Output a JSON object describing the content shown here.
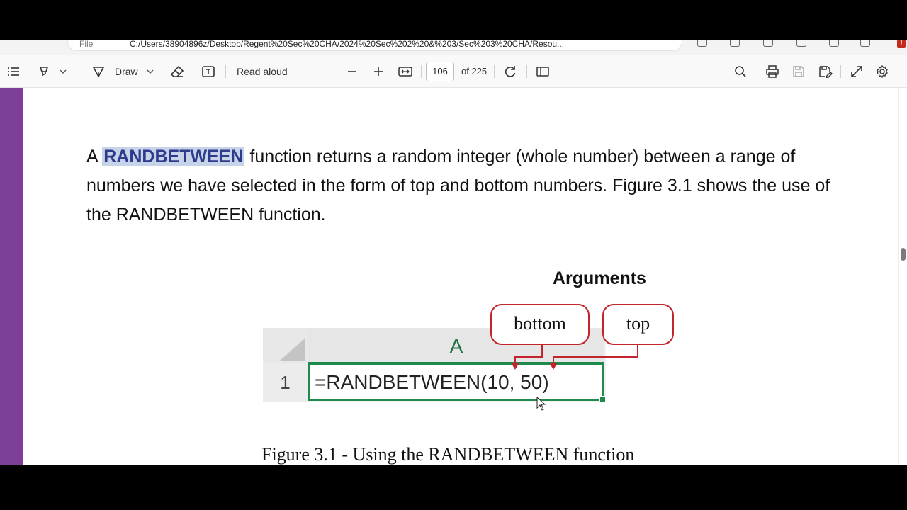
{
  "browser": {
    "scheme": "File",
    "url": "C:/Users/38904896z/Desktop/Regent%20Sec%20CHA/2024%20Sec%202%20&%203/Sec%203%20CHA/Resou..."
  },
  "toolbar": {
    "draw_label": "Draw",
    "read_aloud_label": "Read aloud",
    "page_number": "106",
    "page_total": "of 225"
  },
  "document": {
    "para_prefix": "A ",
    "para_highlight": "RANDBETWEEN",
    "para_rest": " function returns a random integer (whole number) between a range of numbers we have selected in the form of top and bottom numbers. Figure 3.1 shows the use of the RANDBETWEEN function.",
    "figure": {
      "heading": "Arguments",
      "bubble_bottom": "bottom",
      "bubble_top": "top",
      "column_header": "A",
      "row_header": "1",
      "cell_formula": "=RANDBETWEEN(10, 50)",
      "caption": "Figure 3.1 - Using the RANDBETWEEN function"
    }
  },
  "colors": {
    "accent_purple": "#7d3f98",
    "highlight": "#c7d3e8",
    "excel_green": "#1e8a4e",
    "callout_red": "#c0262c",
    "alert_badge": "#c42b1c"
  },
  "icons": [
    "contents-icon",
    "highlight-icon",
    "chevron-down-icon",
    "draw-icon",
    "eraser-icon",
    "text-box-icon",
    "zoom-out-icon",
    "zoom-in-icon",
    "fit-width-icon",
    "rotate-icon",
    "page-view-icon",
    "search-icon",
    "print-icon",
    "save-icon",
    "save-as-icon",
    "expand-icon",
    "settings-icon"
  ]
}
